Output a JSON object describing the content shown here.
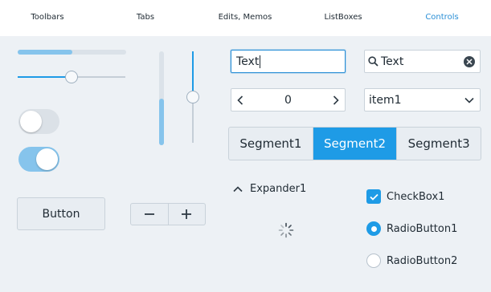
{
  "tabs": [
    {
      "label": "Toolbars",
      "active": false
    },
    {
      "label": "Tabs",
      "active": false
    },
    {
      "label": "Edits, Memos",
      "active": false
    },
    {
      "label": "ListBoxes",
      "active": false
    },
    {
      "label": "Controls",
      "active": true
    }
  ],
  "colors": {
    "accent": "#1e9be6",
    "accent_light": "#86c4ec",
    "active_tab": "#2a8fd6",
    "background": "#edf1f5"
  },
  "controls": {
    "progress_h": {
      "value": 0.5
    },
    "slider_h": {
      "value": 0.5
    },
    "progress_v": {
      "value": 0.5
    },
    "slider_v": {
      "value": 0.5
    },
    "switch_off": {
      "checked": false
    },
    "switch_on": {
      "checked": true
    },
    "button_label": "Button",
    "minus_icon": "minus-icon",
    "plus_icon": "plus-icon",
    "edit1_value": "Text",
    "search_icon": "search-icon",
    "edit2_value": "Text",
    "clear_icon": "clear-icon",
    "spin_value": "0",
    "combo_value": "item1",
    "segments": [
      {
        "label": "Segment1",
        "active": false
      },
      {
        "label": "Segment2",
        "active": true
      },
      {
        "label": "Segment3",
        "active": false
      }
    ],
    "expander_label": "Expander1",
    "checkbox_label": "CheckBox1",
    "checkbox_checked": true,
    "radio1_label": "RadioButton1",
    "radio1_checked": true,
    "radio2_label": "RadioButton2",
    "radio2_checked": false
  }
}
